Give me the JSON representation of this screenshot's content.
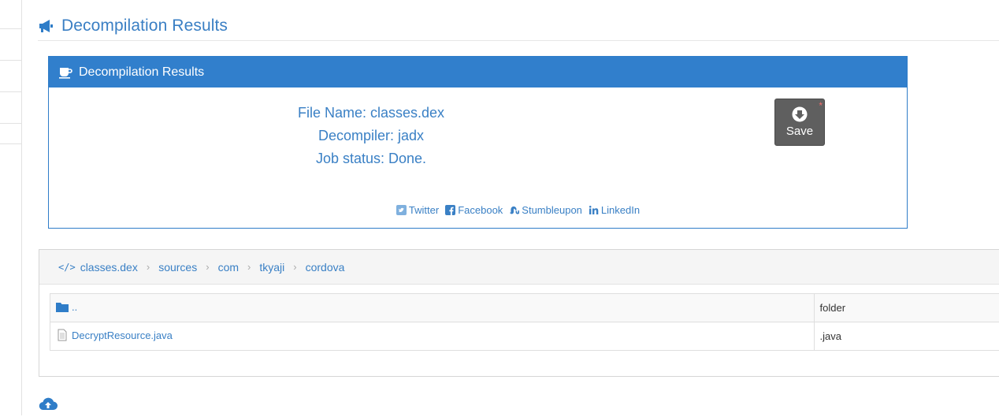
{
  "page": {
    "title": "Decompilation Results"
  },
  "panel": {
    "heading": "Decompilation Results",
    "file_name": "File Name: classes.dex",
    "decompiler": "Decompiler: jadx",
    "job_status": "Job status: Done.",
    "save_label": "Save",
    "badge": "*",
    "share": {
      "twitter": "Twitter",
      "facebook": "Facebook",
      "stumbleupon": "Stumbleupon",
      "linkedin": "LinkedIn"
    }
  },
  "breadcrumb": {
    "items": [
      "classes.dex",
      "sources",
      "com",
      "tkyaji",
      "cordova"
    ],
    "separator": "›"
  },
  "files": {
    "parent": {
      "name": "..",
      "type": "folder"
    },
    "rows": [
      {
        "name": "DecryptResource.java",
        "type": ".java"
      }
    ]
  },
  "colors": {
    "accent": "#317fcc",
    "link": "#3a80c5",
    "save_button": "#5f5f5f"
  },
  "icons": {
    "header": "bullhorn-icon",
    "panel": "coffee-icon",
    "save": "download-icon",
    "breadcrumb": "code-icon",
    "parent": "folder-icon",
    "file": "file-icon",
    "bottom": "cloud-upload-icon"
  }
}
